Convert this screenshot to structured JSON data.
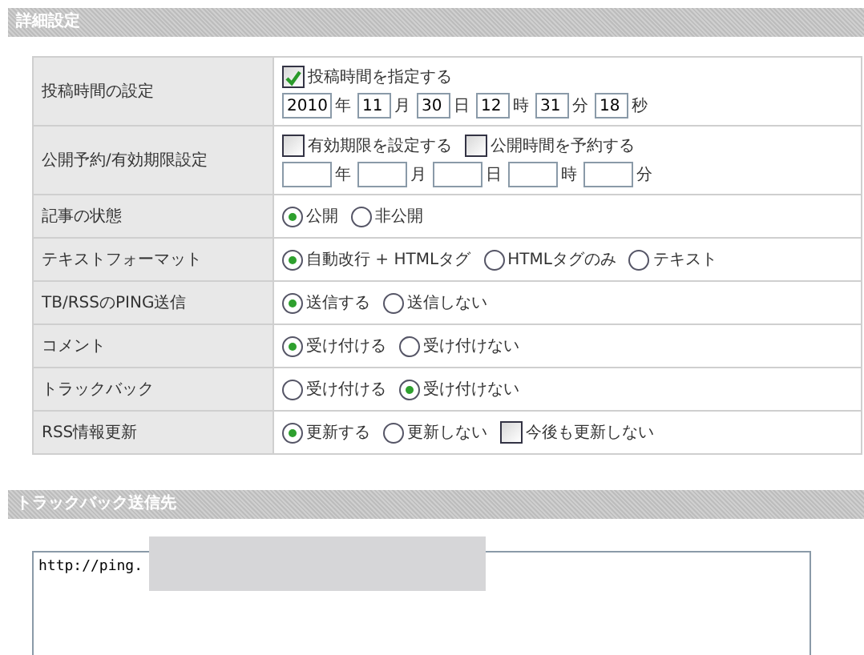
{
  "sections": [
    {
      "kind": "settings",
      "title": "詳細設定",
      "rows": [
        {
          "label": "投稿時間の設定",
          "lines": [
            [
              {
                "kind": "checkbox",
                "label": "投稿時間を指定する",
                "checked": true
              }
            ],
            [
              {
                "kind": "field",
                "value": "2010",
                "unit": "年"
              },
              {
                "kind": "field",
                "value": "11",
                "unit": "月"
              },
              {
                "kind": "field",
                "value": "30",
                "unit": "日"
              },
              {
                "kind": "field",
                "value": "12",
                "unit": "時"
              },
              {
                "kind": "field",
                "value": "31",
                "unit": "分"
              },
              {
                "kind": "field",
                "value": "18",
                "unit": "秒"
              }
            ]
          ]
        },
        {
          "label": "公開予約/有効期限設定",
          "lines": [
            [
              {
                "kind": "checkbox",
                "label": "有効期限を設定する",
                "checked": false
              },
              {
                "kind": "checkbox",
                "label": "公開時間を予約する",
                "checked": false
              }
            ],
            [
              {
                "kind": "field",
                "unit": "年"
              },
              {
                "kind": "field",
                "unit": "月"
              },
              {
                "kind": "field",
                "unit": "日"
              },
              {
                "kind": "field",
                "unit": "時"
              },
              {
                "kind": "field",
                "unit": "分"
              }
            ]
          ]
        },
        {
          "label": "記事の状態",
          "lines": [
            [
              {
                "kind": "radio",
                "label": "公開",
                "selected": true
              },
              {
                "kind": "radio",
                "label": "非公開",
                "selected": false
              }
            ]
          ]
        },
        {
          "label": "テキストフォーマット",
          "lines": [
            [
              {
                "kind": "radio",
                "label": "自動改行 + HTMLタグ",
                "selected": true
              },
              {
                "kind": "radio",
                "label": "HTMLタグのみ",
                "selected": false
              },
              {
                "kind": "radio",
                "label": "テキスト",
                "selected": false
              }
            ]
          ]
        },
        {
          "label": "TB/RSSのPING送信",
          "lines": [
            [
              {
                "kind": "radio",
                "label": "送信する",
                "selected": true
              },
              {
                "kind": "radio",
                "label": "送信しない",
                "selected": false
              }
            ]
          ]
        },
        {
          "label": "コメント",
          "lines": [
            [
              {
                "kind": "radio",
                "label": "受け付ける",
                "selected": true
              },
              {
                "kind": "radio",
                "label": "受け付けない",
                "selected": false
              }
            ]
          ]
        },
        {
          "label": "トラックバック",
          "lines": [
            [
              {
                "kind": "radio",
                "label": "受け付ける",
                "selected": false
              },
              {
                "kind": "radio",
                "label": "受け付けない",
                "selected": true
              }
            ]
          ]
        },
        {
          "label": "RSS情報更新",
          "lines": [
            [
              {
                "kind": "radio",
                "label": "更新する",
                "selected": true
              },
              {
                "kind": "radio",
                "label": "更新しない",
                "selected": false
              },
              {
                "kind": "checkbox",
                "label": "今後も更新しない",
                "checked": false
              }
            ]
          ]
        }
      ]
    },
    {
      "kind": "textarea",
      "title": "トラックバック送信先",
      "value": "http://ping."
    }
  ]
}
